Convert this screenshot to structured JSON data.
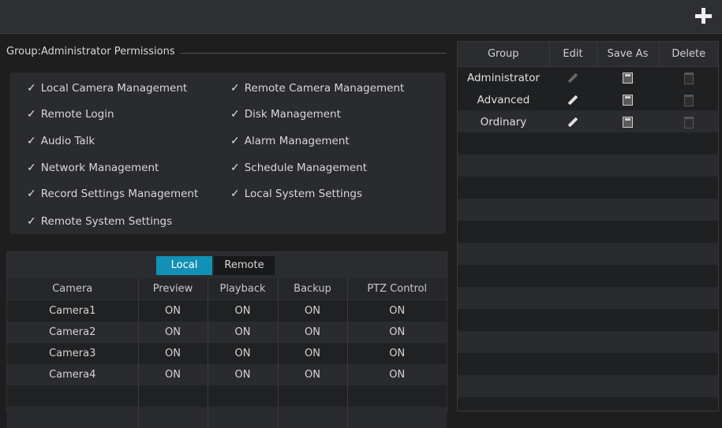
{
  "toolbar": {
    "add_label": "+"
  },
  "group_header": "Group:Administrator Permissions",
  "permissions": {
    "left": [
      "Local Camera Management",
      "Remote Login",
      "Audio Talk",
      "Network Management",
      "Record Settings Management",
      "Remote System Settings"
    ],
    "right": [
      "Remote Camera Management",
      "Disk Management",
      "Alarm Management",
      "Schedule Management",
      "Local System Settings"
    ]
  },
  "tabs": {
    "local": "Local",
    "remote": "Remote",
    "active": "Local"
  },
  "camera_table": {
    "headers": [
      "Camera",
      "Preview",
      "Playback",
      "Backup",
      "PTZ Control"
    ],
    "rows": [
      [
        "Camera1",
        "ON",
        "ON",
        "ON",
        "ON"
      ],
      [
        "Camera2",
        "ON",
        "ON",
        "ON",
        "ON"
      ],
      [
        "Camera3",
        "ON",
        "ON",
        "ON",
        "ON"
      ],
      [
        "Camera4",
        "ON",
        "ON",
        "ON",
        "ON"
      ]
    ]
  },
  "group_table": {
    "headers": [
      "Group",
      "Edit",
      "Save As",
      "Delete"
    ],
    "rows": [
      {
        "name": "Administrator"
      },
      {
        "name": "Advanced"
      },
      {
        "name": "Ordinary"
      }
    ]
  },
  "icons": {
    "check": "check-icon",
    "edit": "pencil-icon",
    "save": "floppy-disk-icon",
    "delete": "trash-icon",
    "add": "plus-icon"
  },
  "colors": {
    "accent": "#1390b5",
    "background": "#1e1e1e"
  }
}
